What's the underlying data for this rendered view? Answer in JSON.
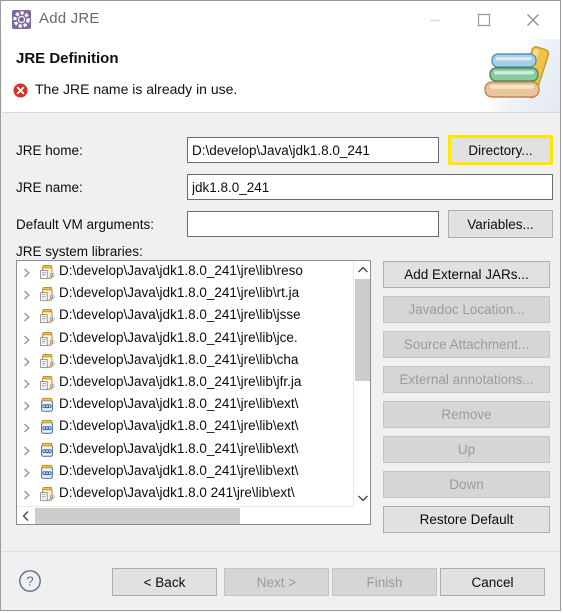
{
  "window": {
    "title": "Add JRE",
    "icon": "jre-gear-icon",
    "controls": {
      "minimize": "minimize-icon",
      "maximize": "maximize-icon",
      "close": "close-icon"
    }
  },
  "header": {
    "title": "JRE Definition",
    "message": "The JRE name is already in use.",
    "status_icon": "error-icon",
    "banner_icon": "books-icon",
    "error_color": "#d93025"
  },
  "form": {
    "jre_home": {
      "label": "JRE home:",
      "value": "D:\\develop\\Java\\jdk1.8.0_241",
      "placeholder": "",
      "button": "Directory...",
      "button_highlight_color": "#ffe800"
    },
    "jre_name": {
      "label": "JRE name:",
      "value": "jdk1.8.0_241",
      "placeholder": ""
    },
    "vm_args": {
      "label": "Default VM arguments:",
      "value": "",
      "placeholder": "",
      "button": "Variables..."
    },
    "libraries_label": "JRE system libraries:"
  },
  "tree": {
    "rows": [
      {
        "text": "D:\\develop\\Java\\jdk1.8.0_241\\jre\\lib\\reso",
        "icon": "jar-doc-icon",
        "expandable": true
      },
      {
        "text": "D:\\develop\\Java\\jdk1.8.0_241\\jre\\lib\\rt.ja",
        "icon": "jar-doc-icon",
        "expandable": true
      },
      {
        "text": "D:\\develop\\Java\\jdk1.8.0_241\\jre\\lib\\jsse",
        "icon": "jar-doc-icon",
        "expandable": true
      },
      {
        "text": "D:\\develop\\Java\\jdk1.8.0_241\\jre\\lib\\jce.",
        "icon": "jar-doc-icon",
        "expandable": true
      },
      {
        "text": "D:\\develop\\Java\\jdk1.8.0_241\\jre\\lib\\cha",
        "icon": "jar-doc-icon",
        "expandable": true
      },
      {
        "text": "D:\\develop\\Java\\jdk1.8.0_241\\jre\\lib\\jfr.ja",
        "icon": "jar-doc-icon",
        "expandable": true
      },
      {
        "text": "D:\\develop\\Java\\jdk1.8.0_241\\jre\\lib\\ext\\",
        "icon": "jar-icon",
        "expandable": true
      },
      {
        "text": "D:\\develop\\Java\\jdk1.8.0_241\\jre\\lib\\ext\\",
        "icon": "jar-icon",
        "expandable": true
      },
      {
        "text": "D:\\develop\\Java\\jdk1.8.0_241\\jre\\lib\\ext\\",
        "icon": "jar-icon",
        "expandable": true
      },
      {
        "text": "D:\\develop\\Java\\jdk1.8.0_241\\jre\\lib\\ext\\",
        "icon": "jar-icon",
        "expandable": true
      },
      {
        "text": "D:\\develop\\Java\\jdk1.8.0 241\\jre\\lib\\ext\\",
        "icon": "jar-doc-icon",
        "expandable": true
      }
    ]
  },
  "side_buttons": [
    {
      "label": "Add External JARs...",
      "enabled": true
    },
    {
      "label": "Javadoc Location...",
      "enabled": false
    },
    {
      "label": "Source Attachment...",
      "enabled": false
    },
    {
      "label": "External annotations...",
      "enabled": false
    },
    {
      "label": "Remove",
      "enabled": false
    },
    {
      "label": "Up",
      "enabled": false
    },
    {
      "label": "Down",
      "enabled": false
    },
    {
      "label": "Restore Default",
      "enabled": true
    }
  ],
  "footer": {
    "help_icon": "help-icon",
    "buttons": [
      {
        "label": "< Back",
        "enabled": true
      },
      {
        "label": "Next >",
        "enabled": false
      },
      {
        "label": "Finish",
        "enabled": false
      },
      {
        "label": "Cancel",
        "enabled": true
      }
    ]
  }
}
